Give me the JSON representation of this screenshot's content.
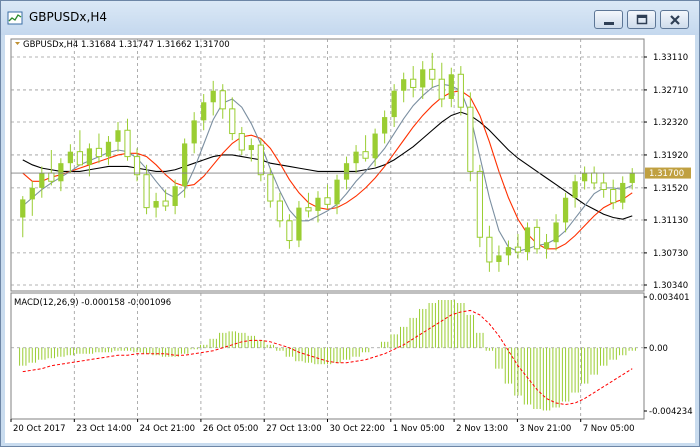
{
  "window": {
    "title": "GBPUSDx,H4",
    "icon": "chart-icon",
    "controls": [
      "minimize-icon",
      "maximize-icon",
      "close-icon"
    ]
  },
  "colors": {
    "bull": "#9acd32",
    "bear": "#9acd32",
    "grid": "#9a9a9a",
    "ma_fast": "#7b8fa1",
    "ma_mid": "#ff3000",
    "ma_slow": "#000000",
    "current_price_line": "#808080",
    "current_price_box": "#c0a040",
    "macd_hist": "#9acd32",
    "macd_signal": "#ff0000",
    "axis_text": "#000000"
  },
  "main_panel": {
    "symbol_info": "GBPUSDx,H4  1.31684 1.31747 1.31662 1.31700",
    "price_ticks": [
      "1.33110",
      "1.32710",
      "1.32320",
      "1.31920",
      "1.31520",
      "1.31130",
      "1.30730",
      "1.30340"
    ],
    "current_price_label": "1.31700"
  },
  "macd_panel": {
    "info": "MACD(12,26,9) -0.000158 -0.001096",
    "ticks": [
      "0.003401",
      "0.00",
      "-0.004234"
    ]
  },
  "time_axis": [
    "20 Oct 2017",
    "23 Oct 14:00",
    "24 Oct 21:00",
    "26 Oct 05:00",
    "27 Oct 13:00",
    "30 Oct 22:00",
    "1 Nov 05:00",
    "2 Nov 13:00",
    "3 Nov 21:00",
    "7 Nov 05:00"
  ],
  "chart_data": {
    "type": "candlestick",
    "symbol": "GBPUSDx",
    "timeframe": "H4",
    "ylim": [
      1.3034,
      1.3311
    ],
    "candles": [
      {
        "o": 1.3116,
        "h": 1.3142,
        "l": 1.3092,
        "c": 1.3138
      },
      {
        "o": 1.3138,
        "h": 1.316,
        "l": 1.3118,
        "c": 1.3152
      },
      {
        "o": 1.3152,
        "h": 1.3178,
        "l": 1.314,
        "c": 1.317
      },
      {
        "o": 1.317,
        "h": 1.3198,
        "l": 1.3155,
        "c": 1.316
      },
      {
        "o": 1.316,
        "h": 1.3188,
        "l": 1.3148,
        "c": 1.3182
      },
      {
        "o": 1.3182,
        "h": 1.3205,
        "l": 1.317,
        "c": 1.3196
      },
      {
        "o": 1.3196,
        "h": 1.3222,
        "l": 1.3186,
        "c": 1.318
      },
      {
        "o": 1.318,
        "h": 1.3206,
        "l": 1.3166,
        "c": 1.32
      },
      {
        "o": 1.32,
        "h": 1.3218,
        "l": 1.3182,
        "c": 1.319
      },
      {
        "o": 1.319,
        "h": 1.3215,
        "l": 1.318,
        "c": 1.3208
      },
      {
        "o": 1.3208,
        "h": 1.3232,
        "l": 1.3196,
        "c": 1.3222
      },
      {
        "o": 1.3222,
        "h": 1.3236,
        "l": 1.3185,
        "c": 1.319
      },
      {
        "o": 1.319,
        "h": 1.32,
        "l": 1.316,
        "c": 1.3168
      },
      {
        "o": 1.3168,
        "h": 1.318,
        "l": 1.312,
        "c": 1.3128
      },
      {
        "o": 1.3128,
        "h": 1.3146,
        "l": 1.3116,
        "c": 1.3136
      },
      {
        "o": 1.3136,
        "h": 1.315,
        "l": 1.3124,
        "c": 1.313
      },
      {
        "o": 1.313,
        "h": 1.3162,
        "l": 1.312,
        "c": 1.3154
      },
      {
        "o": 1.3154,
        "h": 1.3212,
        "l": 1.314,
        "c": 1.3206
      },
      {
        "o": 1.3206,
        "h": 1.3244,
        "l": 1.3194,
        "c": 1.3234
      },
      {
        "o": 1.3234,
        "h": 1.3266,
        "l": 1.3222,
        "c": 1.3256
      },
      {
        "o": 1.3256,
        "h": 1.3282,
        "l": 1.324,
        "c": 1.327
      },
      {
        "o": 1.327,
        "h": 1.3278,
        "l": 1.3236,
        "c": 1.3248
      },
      {
        "o": 1.3248,
        "h": 1.3262,
        "l": 1.321,
        "c": 1.3218
      },
      {
        "o": 1.3218,
        "h": 1.3226,
        "l": 1.3192,
        "c": 1.3198
      },
      {
        "o": 1.3198,
        "h": 1.3212,
        "l": 1.3184,
        "c": 1.3204
      },
      {
        "o": 1.3204,
        "h": 1.3212,
        "l": 1.316,
        "c": 1.3168
      },
      {
        "o": 1.3168,
        "h": 1.3176,
        "l": 1.3128,
        "c": 1.3136
      },
      {
        "o": 1.3136,
        "h": 1.3146,
        "l": 1.3104,
        "c": 1.3112
      },
      {
        "o": 1.3112,
        "h": 1.312,
        "l": 1.3078,
        "c": 1.3088
      },
      {
        "o": 1.3088,
        "h": 1.3136,
        "l": 1.308,
        "c": 1.3128
      },
      {
        "o": 1.3128,
        "h": 1.3146,
        "l": 1.3116,
        "c": 1.3124
      },
      {
        "o": 1.3124,
        "h": 1.3148,
        "l": 1.311,
        "c": 1.314
      },
      {
        "o": 1.314,
        "h": 1.3156,
        "l": 1.3126,
        "c": 1.3132
      },
      {
        "o": 1.3132,
        "h": 1.3168,
        "l": 1.312,
        "c": 1.3162
      },
      {
        "o": 1.3162,
        "h": 1.319,
        "l": 1.315,
        "c": 1.3182
      },
      {
        "o": 1.3182,
        "h": 1.3204,
        "l": 1.317,
        "c": 1.3196
      },
      {
        "o": 1.3196,
        "h": 1.3216,
        "l": 1.3184,
        "c": 1.3188
      },
      {
        "o": 1.3188,
        "h": 1.3224,
        "l": 1.3178,
        "c": 1.3218
      },
      {
        "o": 1.3218,
        "h": 1.3246,
        "l": 1.3206,
        "c": 1.3238
      },
      {
        "o": 1.3238,
        "h": 1.3278,
        "l": 1.3226,
        "c": 1.327
      },
      {
        "o": 1.327,
        "h": 1.3292,
        "l": 1.3256,
        "c": 1.3284
      },
      {
        "o": 1.3284,
        "h": 1.33,
        "l": 1.3262,
        "c": 1.3274
      },
      {
        "o": 1.3274,
        "h": 1.3306,
        "l": 1.326,
        "c": 1.3296
      },
      {
        "o": 1.3296,
        "h": 1.3316,
        "l": 1.3274,
        "c": 1.3284
      },
      {
        "o": 1.3284,
        "h": 1.3304,
        "l": 1.325,
        "c": 1.326
      },
      {
        "o": 1.326,
        "h": 1.3298,
        "l": 1.325,
        "c": 1.329
      },
      {
        "o": 1.329,
        "h": 1.33,
        "l": 1.324,
        "c": 1.325
      },
      {
        "o": 1.325,
        "h": 1.3268,
        "l": 1.316,
        "c": 1.3172
      },
      {
        "o": 1.3172,
        "h": 1.318,
        "l": 1.308,
        "c": 1.3092
      },
      {
        "o": 1.3092,
        "h": 1.3106,
        "l": 1.305,
        "c": 1.3062
      },
      {
        "o": 1.3062,
        "h": 1.3082,
        "l": 1.305,
        "c": 1.307
      },
      {
        "o": 1.307,
        "h": 1.3088,
        "l": 1.3058,
        "c": 1.308
      },
      {
        "o": 1.308,
        "h": 1.3096,
        "l": 1.3066,
        "c": 1.3074
      },
      {
        "o": 1.3074,
        "h": 1.311,
        "l": 1.3064,
        "c": 1.3104
      },
      {
        "o": 1.3104,
        "h": 1.3114,
        "l": 1.3072,
        "c": 1.3078
      },
      {
        "o": 1.3078,
        "h": 1.3096,
        "l": 1.3066,
        "c": 1.3086
      },
      {
        "o": 1.3086,
        "h": 1.312,
        "l": 1.3076,
        "c": 1.311
      },
      {
        "o": 1.311,
        "h": 1.3146,
        "l": 1.3098,
        "c": 1.314
      },
      {
        "o": 1.314,
        "h": 1.3168,
        "l": 1.3128,
        "c": 1.316
      },
      {
        "o": 1.316,
        "h": 1.3178,
        "l": 1.315,
        "c": 1.317
      },
      {
        "o": 1.317,
        "h": 1.3178,
        "l": 1.315,
        "c": 1.3158
      },
      {
        "o": 1.3158,
        "h": 1.317,
        "l": 1.314,
        "c": 1.315
      },
      {
        "o": 1.315,
        "h": 1.3162,
        "l": 1.3126,
        "c": 1.3134
      },
      {
        "o": 1.3134,
        "h": 1.3166,
        "l": 1.3126,
        "c": 1.3158
      },
      {
        "o": 1.3158,
        "h": 1.3176,
        "l": 1.315,
        "c": 1.317
      }
    ],
    "ma_fast": [
      1.313,
      1.314,
      1.315,
      1.3158,
      1.3165,
      1.3172,
      1.318,
      1.3185,
      1.319,
      1.3195,
      1.3198,
      1.3196,
      1.3188,
      1.3175,
      1.316,
      1.3146,
      1.314,
      1.315,
      1.3175,
      1.3205,
      1.3235,
      1.3255,
      1.326,
      1.325,
      1.323,
      1.3205,
      1.3175,
      1.3148,
      1.3125,
      1.3112,
      1.3112,
      1.3118,
      1.3124,
      1.3132,
      1.3145,
      1.316,
      1.3172,
      1.3186,
      1.32,
      1.3218,
      1.3236,
      1.3252,
      1.3264,
      1.3274,
      1.3278,
      1.3276,
      1.327,
      1.324,
      1.319,
      1.314,
      1.31,
      1.308,
      1.3075,
      1.3078,
      1.3082,
      1.3084,
      1.309,
      1.31,
      1.3115,
      1.313,
      1.3145,
      1.3152,
      1.3152,
      1.315,
      1.3155
    ],
    "ma_mid": [
      1.317,
      1.316,
      1.316,
      1.3165,
      1.3168,
      1.3172,
      1.3176,
      1.318,
      1.3184,
      1.3188,
      1.3192,
      1.3194,
      1.3194,
      1.319,
      1.318,
      1.3168,
      1.3158,
      1.3154,
      1.3156,
      1.3166,
      1.318,
      1.3194,
      1.3206,
      1.3214,
      1.3216,
      1.3212,
      1.32,
      1.3182,
      1.3162,
      1.3146,
      1.3134,
      1.3128,
      1.3126,
      1.3128,
      1.3134,
      1.3142,
      1.3152,
      1.3164,
      1.3178,
      1.3194,
      1.321,
      1.3226,
      1.324,
      1.3252,
      1.3262,
      1.3268,
      1.327,
      1.3262,
      1.324,
      1.3208,
      1.3172,
      1.314,
      1.3114,
      1.3096,
      1.3084,
      1.3078,
      1.3078,
      1.3084,
      1.3094,
      1.3106,
      1.3118,
      1.3128,
      1.3134,
      1.3138,
      1.3146
    ],
    "ma_slow": [
      1.3186,
      1.318,
      1.3176,
      1.3174,
      1.3172,
      1.3172,
      1.3172,
      1.3174,
      1.3176,
      1.3178,
      1.3178,
      1.3178,
      1.3176,
      1.3174,
      1.3172,
      1.3172,
      1.3174,
      1.3178,
      1.3182,
      1.3186,
      1.319,
      1.3192,
      1.3192,
      1.319,
      1.3188,
      1.3186,
      1.3182,
      1.318,
      1.3178,
      1.3176,
      1.3174,
      1.3172,
      1.3172,
      1.3172,
      1.3172,
      1.3172,
      1.3174,
      1.3176,
      1.318,
      1.3186,
      1.3194,
      1.3202,
      1.3212,
      1.3222,
      1.3232,
      1.324,
      1.3244,
      1.324,
      1.3232,
      1.3222,
      1.321,
      1.3198,
      1.3188,
      1.318,
      1.3172,
      1.3164,
      1.3156,
      1.3148,
      1.314,
      1.3132,
      1.3126,
      1.312,
      1.3116,
      1.3114,
      1.3118
    ],
    "macd_ylim": [
      -0.004234,
      0.003401
    ],
    "macd_hist": [
      -0.0012,
      -0.001,
      -0.0008,
      -0.0007,
      -0.0006,
      -0.0005,
      -0.0004,
      -0.0004,
      -0.0003,
      -0.0003,
      -0.0002,
      -0.0002,
      -0.0003,
      -0.0004,
      -0.0005,
      -0.0006,
      -0.0006,
      -0.0004,
      -0.0001,
      0.0002,
      0.0006,
      0.001,
      0.0011,
      0.001,
      0.0008,
      0.0005,
      0.0002,
      -0.0002,
      -0.0006,
      -0.0009,
      -0.001,
      -0.0011,
      -0.0011,
      -0.001,
      -0.0008,
      -0.0006,
      -0.0003,
      0.0,
      0.0004,
      0.0009,
      0.0014,
      0.002,
      0.0026,
      0.003,
      0.0032,
      0.0032,
      0.003,
      0.0022,
      0.001,
      -0.0002,
      -0.0014,
      -0.0024,
      -0.0032,
      -0.0038,
      -0.0041,
      -0.0042,
      -0.004,
      -0.0036,
      -0.003,
      -0.0024,
      -0.0018,
      -0.0012,
      -0.0008,
      -0.0005,
      -0.0002
    ],
    "macd_signal": [
      -0.0016,
      -0.0015,
      -0.0014,
      -0.0012,
      -0.0011,
      -0.001,
      -0.0009,
      -0.0008,
      -0.0007,
      -0.0006,
      -0.0005,
      -0.0005,
      -0.0004,
      -0.0004,
      -0.0004,
      -0.0004,
      -0.0005,
      -0.0005,
      -0.0004,
      -0.0003,
      -0.0002,
      0.0,
      0.0002,
      0.0004,
      0.0005,
      0.0005,
      0.0004,
      0.0002,
      0.0,
      -0.0003,
      -0.0005,
      -0.0007,
      -0.0009,
      -0.001,
      -0.001,
      -0.0009,
      -0.0008,
      -0.0006,
      -0.0004,
      -0.0001,
      0.0002,
      0.0006,
      0.001,
      0.0014,
      0.0018,
      0.0022,
      0.0024,
      0.0025,
      0.0022,
      0.0016,
      0.0008,
      -0.0002,
      -0.0012,
      -0.002,
      -0.0028,
      -0.0034,
      -0.0037,
      -0.0038,
      -0.0037,
      -0.0034,
      -0.003,
      -0.0026,
      -0.0022,
      -0.0018,
      -0.0014
    ]
  }
}
